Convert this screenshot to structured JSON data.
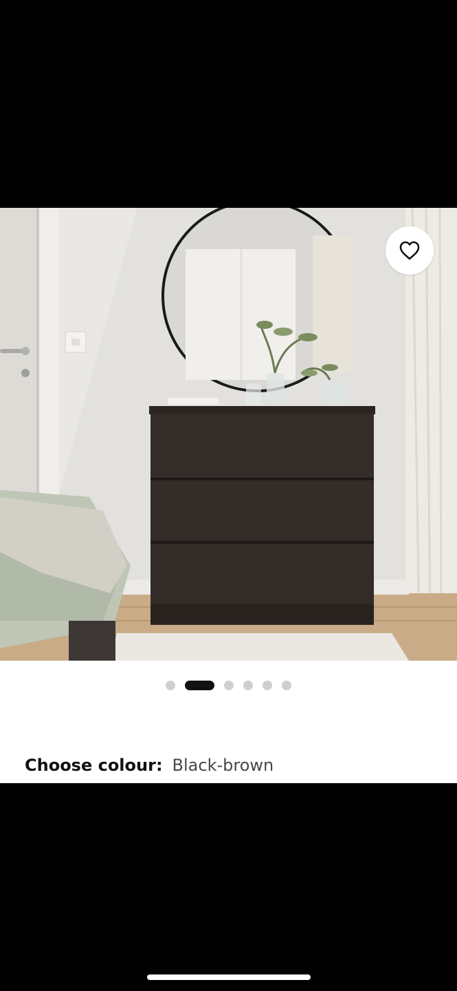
{
  "product_gallery": {
    "image_alt": "Black-brown chest of 3 drawers in a bedroom with a round mirror",
    "favourite_icon": "heart-outline-icon",
    "slide_count": 6,
    "active_slide": 2
  },
  "colour_selector": {
    "label": "Choose colour:",
    "value": "Black-brown"
  },
  "colors": {
    "accent": "#111111",
    "dot_inactive": "#cfcfcf",
    "dresser": "#2d2623"
  }
}
